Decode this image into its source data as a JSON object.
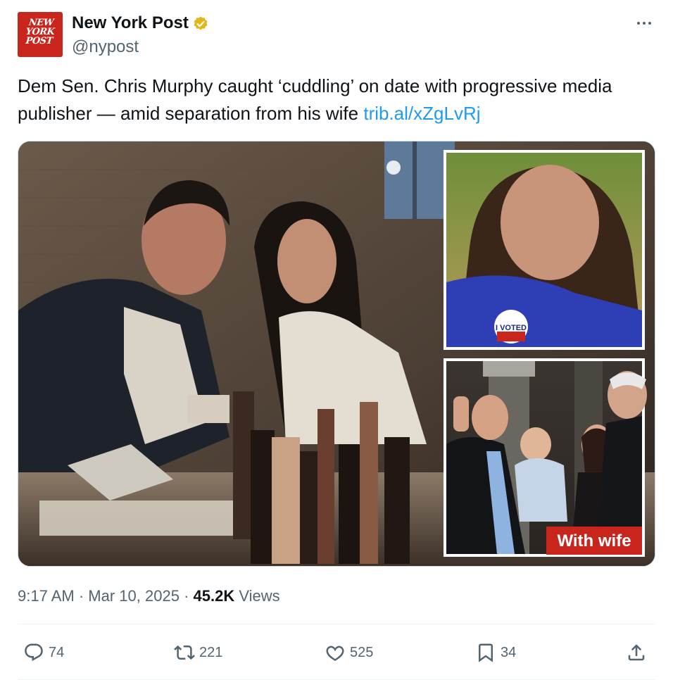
{
  "account": {
    "avatar_text": "NEW YORK POST",
    "display_name": "New York Post",
    "handle": "@nypost",
    "verified_color": "#e2b719"
  },
  "tweet": {
    "text": "Dem Sen. Chris Murphy caught ‘cuddling’ on date with progressive media publisher — amid separation from his wife",
    "link": "trib.al/xZgLvRj"
  },
  "media": {
    "overlay_label": "With wife",
    "sticker_text": "I VOTED",
    "label_color": "#c8261c"
  },
  "meta": {
    "time": "9:17 AM",
    "separator": "·",
    "date": "Mar 10, 2025",
    "views_count": "45.2K",
    "views_label": "Views"
  },
  "actions": {
    "replies": "74",
    "reposts": "221",
    "likes": "525",
    "bookmarks": "34"
  },
  "icons": [
    "verified-badge-icon",
    "more-options-icon",
    "reply-icon",
    "repost-icon",
    "like-icon",
    "bookmark-icon",
    "share-icon"
  ]
}
